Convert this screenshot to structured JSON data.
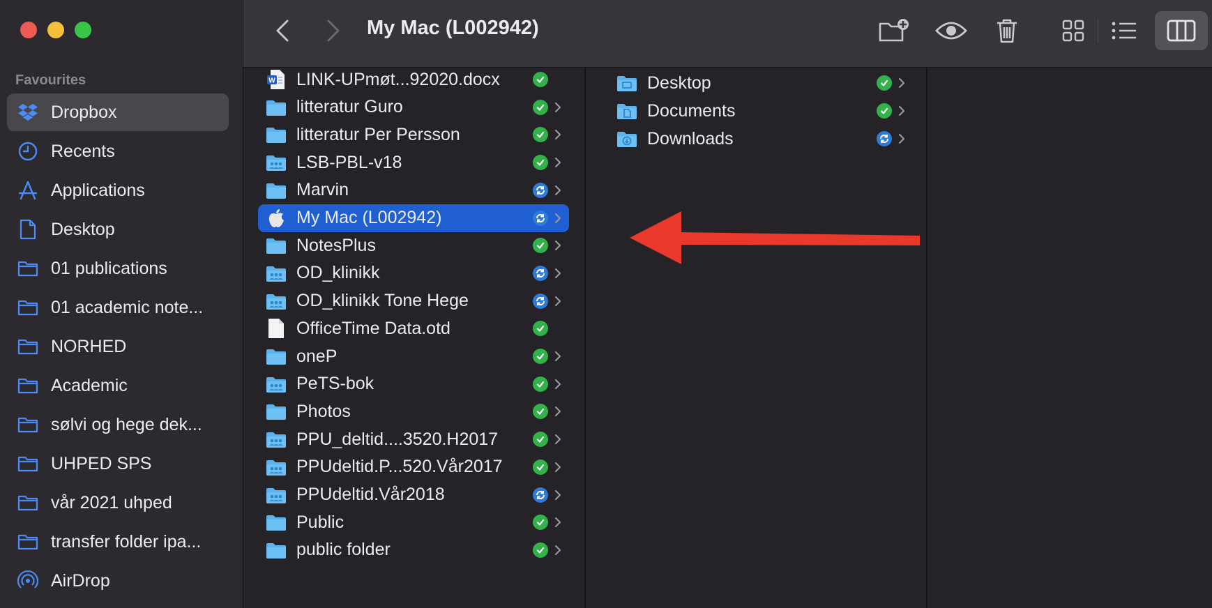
{
  "window": {
    "title": "My Mac (L002942)"
  },
  "sidebar": {
    "section": "Favourites",
    "items": [
      {
        "label": "Dropbox",
        "icon": "dropbox-icon",
        "active": true
      },
      {
        "label": "Recents",
        "icon": "clock-icon"
      },
      {
        "label": "Applications",
        "icon": "applications-icon"
      },
      {
        "label": "Desktop",
        "icon": "document-icon"
      },
      {
        "label": "01 publications",
        "icon": "folder-icon"
      },
      {
        "label": "01 academic note...",
        "icon": "folder-icon"
      },
      {
        "label": "NORHED",
        "icon": "folder-icon"
      },
      {
        "label": "Academic",
        "icon": "folder-icon"
      },
      {
        "label": "sølvi og hege dek...",
        "icon": "folder-icon"
      },
      {
        "label": "UHPED SPS",
        "icon": "folder-icon"
      },
      {
        "label": "vår 2021 uhped",
        "icon": "folder-icon"
      },
      {
        "label": "transfer folder ipa...",
        "icon": "folder-icon"
      },
      {
        "label": "AirDrop",
        "icon": "airdrop-icon"
      }
    ]
  },
  "column1": {
    "items": [
      {
        "name": "LINK-UPmøt...92020.docx",
        "type": "word",
        "status": "ok",
        "chevron": false
      },
      {
        "name": "litteratur Guro",
        "type": "folder",
        "status": "ok",
        "chevron": true
      },
      {
        "name": "litteratur Per Persson",
        "type": "folder",
        "status": "ok",
        "chevron": true
      },
      {
        "name": "LSB-PBL-v18",
        "type": "shared",
        "status": "ok",
        "chevron": true
      },
      {
        "name": "Marvin",
        "type": "folder",
        "status": "sync",
        "chevron": true
      },
      {
        "name": "My Mac (L002942)",
        "type": "apple",
        "status": "sync",
        "chevron": true,
        "selected": true
      },
      {
        "name": "NotesPlus",
        "type": "folder",
        "status": "ok",
        "chevron": true
      },
      {
        "name": "OD_klinikk",
        "type": "shared",
        "status": "sync",
        "chevron": true
      },
      {
        "name": "OD_klinikk Tone Hege",
        "type": "shared",
        "status": "sync",
        "chevron": true
      },
      {
        "name": "OfficeTime Data.otd",
        "type": "file",
        "status": "ok",
        "chevron": false
      },
      {
        "name": "oneP",
        "type": "folder",
        "status": "ok",
        "chevron": true
      },
      {
        "name": "PeTS-bok",
        "type": "shared",
        "status": "ok",
        "chevron": true
      },
      {
        "name": "Photos",
        "type": "folder",
        "status": "ok",
        "chevron": true
      },
      {
        "name": "PPU_deltid....3520.H2017",
        "type": "shared",
        "status": "ok",
        "chevron": true
      },
      {
        "name": "PPUdeltid.P...520.Vår2017",
        "type": "shared",
        "status": "ok",
        "chevron": true
      },
      {
        "name": "PPUdeltid.Vår2018",
        "type": "shared",
        "status": "sync",
        "chevron": true
      },
      {
        "name": "Public",
        "type": "folder",
        "status": "ok",
        "chevron": true
      },
      {
        "name": "public folder",
        "type": "folder",
        "status": "ok",
        "chevron": true
      }
    ]
  },
  "column2": {
    "items": [
      {
        "name": "Desktop",
        "type": "desktop",
        "status": "ok",
        "chevron": true
      },
      {
        "name": "Documents",
        "type": "documents",
        "status": "ok",
        "chevron": true
      },
      {
        "name": "Downloads",
        "type": "downloads",
        "status": "sync",
        "chevron": true
      }
    ]
  },
  "colors": {
    "accent": "#1f5fd1",
    "ok": "#33b24b",
    "sync": "#2e7bd8",
    "arrow": "#e8392a",
    "folder": "#5ab3ec"
  }
}
